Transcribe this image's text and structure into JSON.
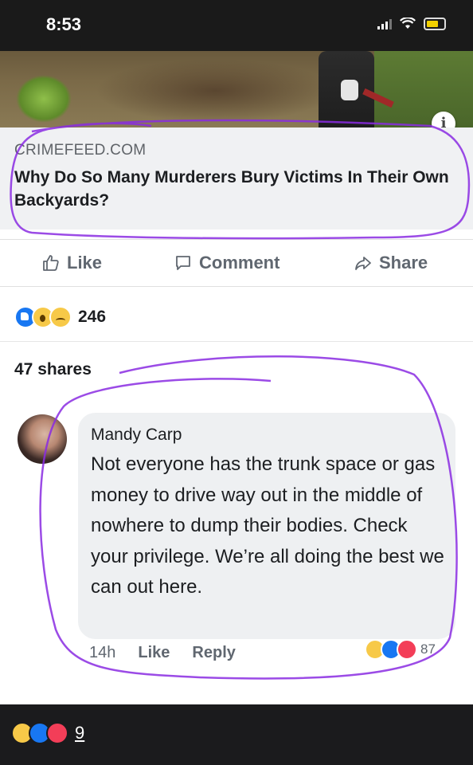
{
  "status_bar": {
    "time": "8:53"
  },
  "link_preview": {
    "domain": "CRIMEFEED.COM",
    "headline": "Why Do So Many Murderers Bury Victims In Their Own Backyards?",
    "info_icon": "i"
  },
  "actions": {
    "like": "Like",
    "comment": "Comment",
    "share": "Share"
  },
  "reactions_summary": {
    "icons": [
      "like-icon",
      "wow-icon",
      "sad-icon"
    ],
    "count": "246"
  },
  "shares": "47 shares",
  "comment": {
    "author": "Mandy Carp",
    "text": "Not everyone has the trunk space or gas money to drive way out in the middle of nowhere to dump their bodies. Check your privilege. We’re all doing the best we can out here.",
    "time_ago": "14h",
    "like_label": "Like",
    "reply_label": "Reply",
    "reaction_icons": [
      "haha-icon",
      "wow-icon",
      "love-icon"
    ],
    "reaction_count": "87"
  },
  "bottom_bar": {
    "reaction_icons": [
      "haha-icon",
      "like-icon",
      "love-icon"
    ],
    "count": "9"
  },
  "colors": {
    "annotation": "#8a2be2",
    "accent": "#1877f2",
    "love": "#f33e58",
    "haha": "#f7c948"
  }
}
